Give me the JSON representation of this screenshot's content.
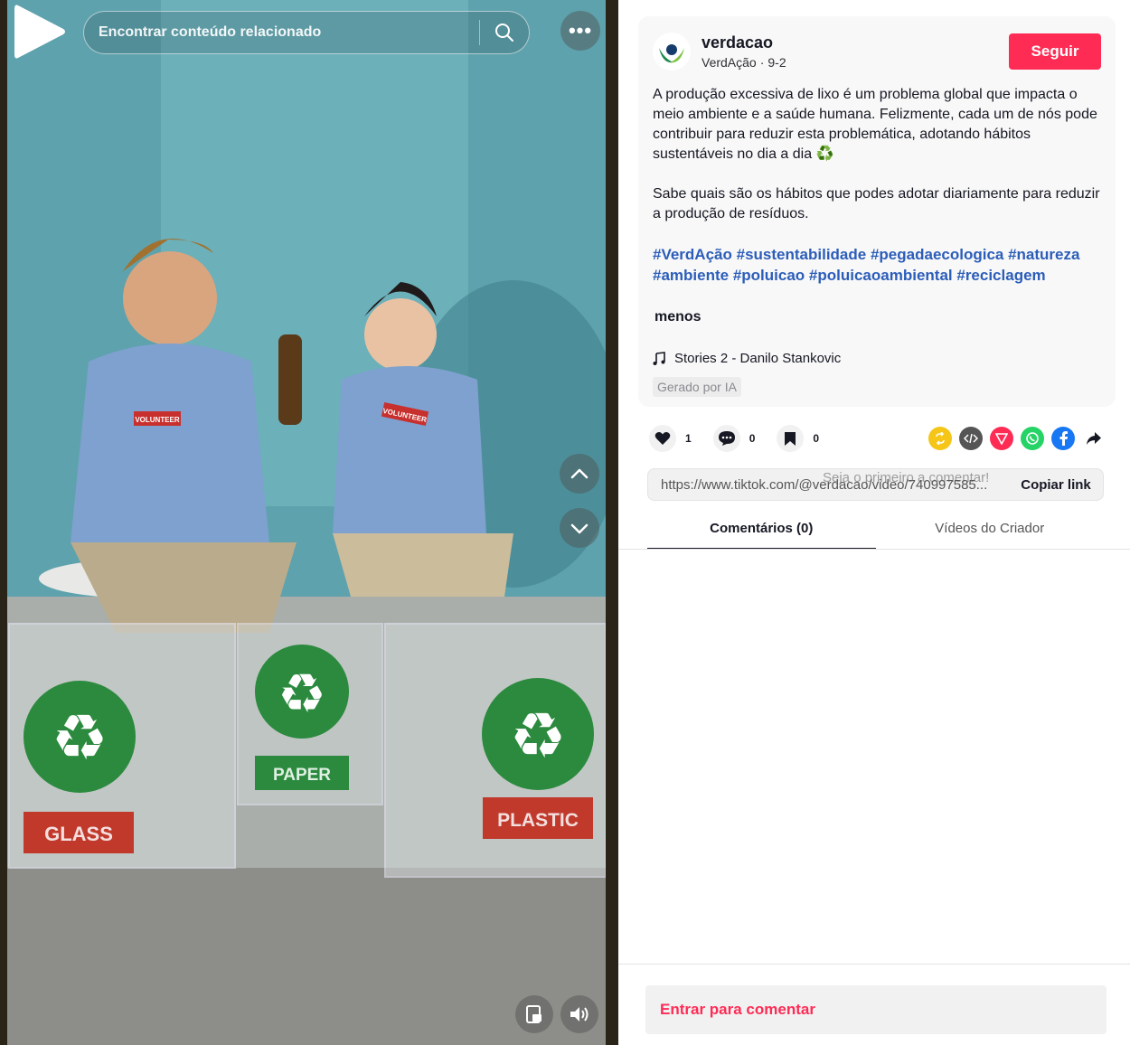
{
  "video": {
    "search_placeholder": "Encontrar conteúdo relacionado",
    "close_icon": "close-icon",
    "more_icon": "more-icon",
    "bin_labels": [
      "GLASS",
      "PAPER",
      "PLASTIC"
    ],
    "shirt_label": "VOLUNTEER"
  },
  "post": {
    "author_name": "verdacao",
    "author_nick": "VerdAção",
    "separator": "·",
    "date": "9-2",
    "follow_label": "Seguir",
    "description_1": "A produção excessiva de lixo é um problema global que impacta o meio ambiente e a saúde humana. Felizmente, cada um de nós pode contribuir para reduzir esta problemática, adotando hábitos sustentáveis no dia a dia ♻️",
    "description_2": "Sabe quais são os hábitos que podes adotar diariamente para reduzir a produção de resíduos.",
    "hashtags": [
      "#VerdAção",
      "#sustentabilidade",
      "#pegadaecologica",
      "#natureza",
      "#ambiente",
      "#poluicao",
      "#poluicaoambiental",
      "#reciclagem"
    ],
    "less_label": "menos",
    "music": "Stories 2 - Danilo Stankovic",
    "ai_badge": "Gerado por IA"
  },
  "actions": {
    "likes": "1",
    "comments": "0",
    "saves": "0",
    "share_icons": [
      "repost-icon",
      "embed-icon",
      "send-icon",
      "whatsapp-icon",
      "facebook-icon",
      "share-arrow-icon"
    ]
  },
  "link": {
    "url": "https://www.tiktok.com/@verdacao/video/740997585...",
    "overlay_hint": "Seja o primeiro a comentar!",
    "copy_label": "Copiar link"
  },
  "tabs": [
    "Comentários (0)",
    "Vídeos do Criador"
  ],
  "comment": {
    "login_label": "Entrar para comentar"
  },
  "colors": {
    "accent": "#fe2c55",
    "hashtag": "#2b5db9"
  }
}
